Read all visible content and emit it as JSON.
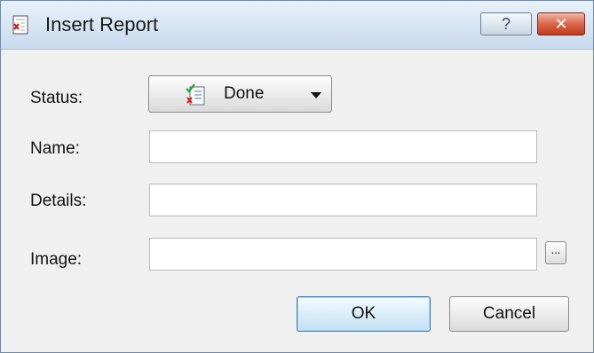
{
  "window": {
    "title": "Insert Report",
    "help_label": "?",
    "close_label": "✕"
  },
  "form": {
    "status": {
      "label": "Status:",
      "value": "Done"
    },
    "name": {
      "label": "Name:",
      "value": "",
      "placeholder": ""
    },
    "details": {
      "label": "Details:",
      "value": "",
      "placeholder": ""
    },
    "image": {
      "label": "Image:",
      "value": "",
      "placeholder": "",
      "browse_label": "..."
    }
  },
  "buttons": {
    "ok": "OK",
    "cancel": "Cancel"
  },
  "icons": {
    "title": "report-icon",
    "status": "done-report-icon"
  },
  "colors": {
    "accent": "#3c7fb1",
    "close": "#c23b1e"
  }
}
